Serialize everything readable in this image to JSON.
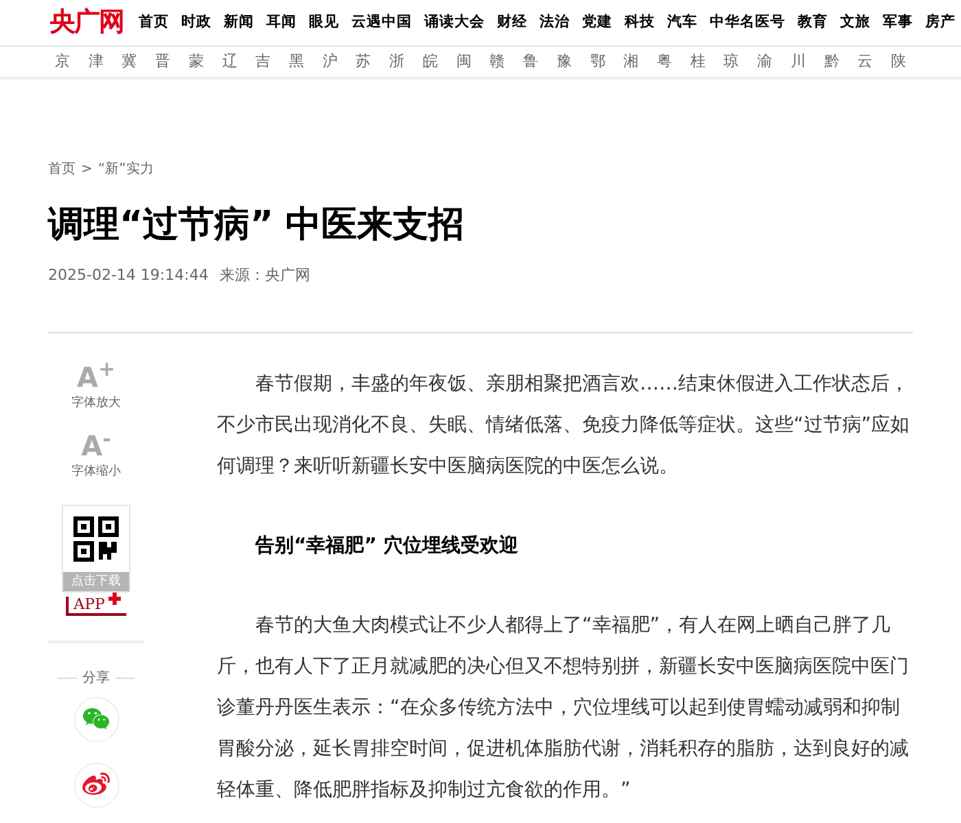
{
  "header": {
    "logo": "央广网",
    "nav": [
      "首页",
      "时政",
      "新闻",
      "耳闻",
      "眼见",
      "云遇中国",
      "诵读大会",
      "财经",
      "法治",
      "党建",
      "科技",
      "汽车",
      "中华名医号",
      "教育",
      "文旅",
      "军事",
      "房产"
    ],
    "regions": [
      "京",
      "津",
      "冀",
      "晋",
      "蒙",
      "辽",
      "吉",
      "黑",
      "沪",
      "苏",
      "浙",
      "皖",
      "闽",
      "赣",
      "鲁",
      "豫",
      "鄂",
      "湘",
      "粤",
      "桂",
      "琼",
      "渝",
      "川",
      "黔",
      "云",
      "陕"
    ]
  },
  "breadcrumb": {
    "items": [
      "首页",
      "“新”实力"
    ],
    "separator": ">"
  },
  "article": {
    "title": "调理“过节病” 中医来支招",
    "date": "2025-02-14 19:14:44",
    "source": "来源：央广网",
    "blocks": [
      {
        "kind": "paragraph",
        "text": "春节假期，丰盛的年夜饭、亲朋相聚把酒言欢……结束休假进入工作状态后，不少市民出现消化不良、失眠、情绪低落、免疫力降低等症状。这些“过节病”应如何调理？来听听新疆长安中医脑病医院的中医怎么说。"
      },
      {
        "kind": "heading",
        "text": "告别“幸福肥” 穴位埋线受欢迎"
      },
      {
        "kind": "paragraph",
        "text": "春节的大鱼大肉模式让不少人都得上了“幸福肥”，有人在网上晒自己胖了几斤，也有人下了正月就减肥的决心但又不想特别拼，新疆长安中医脑病医院中医门诊董丹丹医生表示：“在众多传统方法中，穴位埋线可以起到使胃蠕动减弱和抑制胃酸分泌，延长胃排空时间，促进机体脂肪代谢，消耗积存的脂肪，达到良好的减轻体重、降低肥胖指标及抑制过亢食欲的作用。”"
      }
    ]
  },
  "sidebar": {
    "font_buttons": [
      {
        "glyph": "A$^{+}$",
        "label": "字体放大"
      },
      {
        "glyph": "A$^{-}$",
        "label": "字体缩小"
      }
    ],
    "app": {
      "caption": "点击下载",
      "badge": "APP"
    },
    "share_label": "分享"
  }
}
